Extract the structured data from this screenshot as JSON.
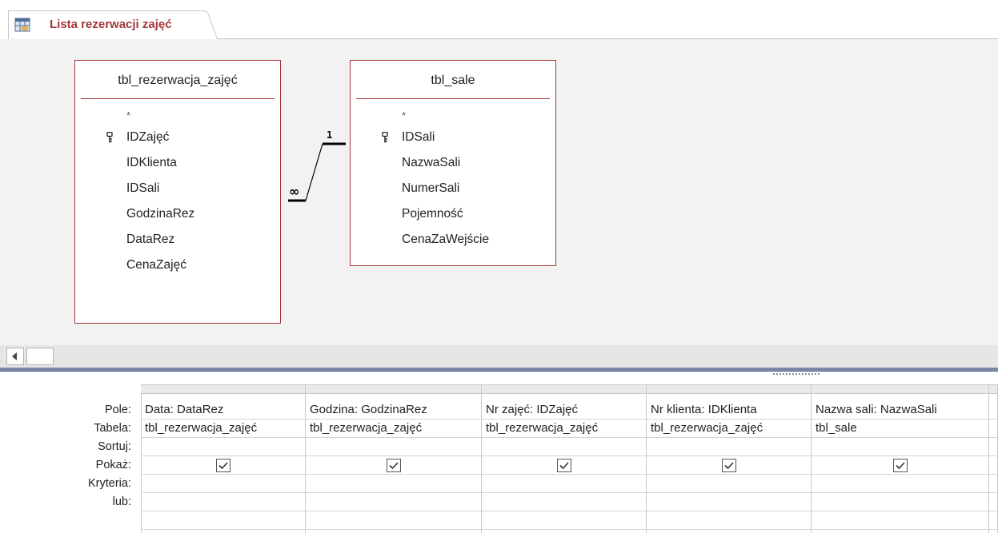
{
  "tab": {
    "label": "Lista rezerwacji zajęć",
    "icon": "query-icon",
    "accent": "#a4373a"
  },
  "tables": [
    {
      "title": "tbl_rezerwacja_zajęć",
      "star": "*",
      "fields": [
        {
          "name": "IDZajęć",
          "key": true
        },
        {
          "name": "IDKlienta",
          "key": false
        },
        {
          "name": "IDSali",
          "key": false
        },
        {
          "name": "GodzinaRez",
          "key": false
        },
        {
          "name": "DataRez",
          "key": false
        },
        {
          "name": "CenaZajęć",
          "key": false
        }
      ]
    },
    {
      "title": "tbl_sale",
      "star": "*",
      "fields": [
        {
          "name": "IDSali",
          "key": true
        },
        {
          "name": "NazwaSali",
          "key": false
        },
        {
          "name": "NumerSali",
          "key": false
        },
        {
          "name": "Pojemność",
          "key": false
        },
        {
          "name": "CenaZaWejście",
          "key": false
        }
      ]
    }
  ],
  "relationship": {
    "many_label": "∞",
    "one_label": "1"
  },
  "grid": {
    "row_labels": [
      "Pole:",
      "Tabela:",
      "Sortuj:",
      "Pokaż:",
      "Kryteria:",
      "lub:"
    ],
    "columns": [
      {
        "field": "Data: DataRez",
        "table": "tbl_rezerwacja_zajęć",
        "sort": "",
        "show": true
      },
      {
        "field": "Godzina: GodzinaRez",
        "table": "tbl_rezerwacja_zajęć",
        "sort": "",
        "show": true
      },
      {
        "field": "Nr zajęć: IDZajęć",
        "table": "tbl_rezerwacja_zajęć",
        "sort": "",
        "show": true
      },
      {
        "field": "Nr klienta: IDKlienta",
        "table": "tbl_rezerwacja_zajęć",
        "sort": "",
        "show": true
      },
      {
        "field": "Nazwa sali: NazwaSali",
        "table": "tbl_sale",
        "sort": "",
        "show": true
      }
    ]
  }
}
